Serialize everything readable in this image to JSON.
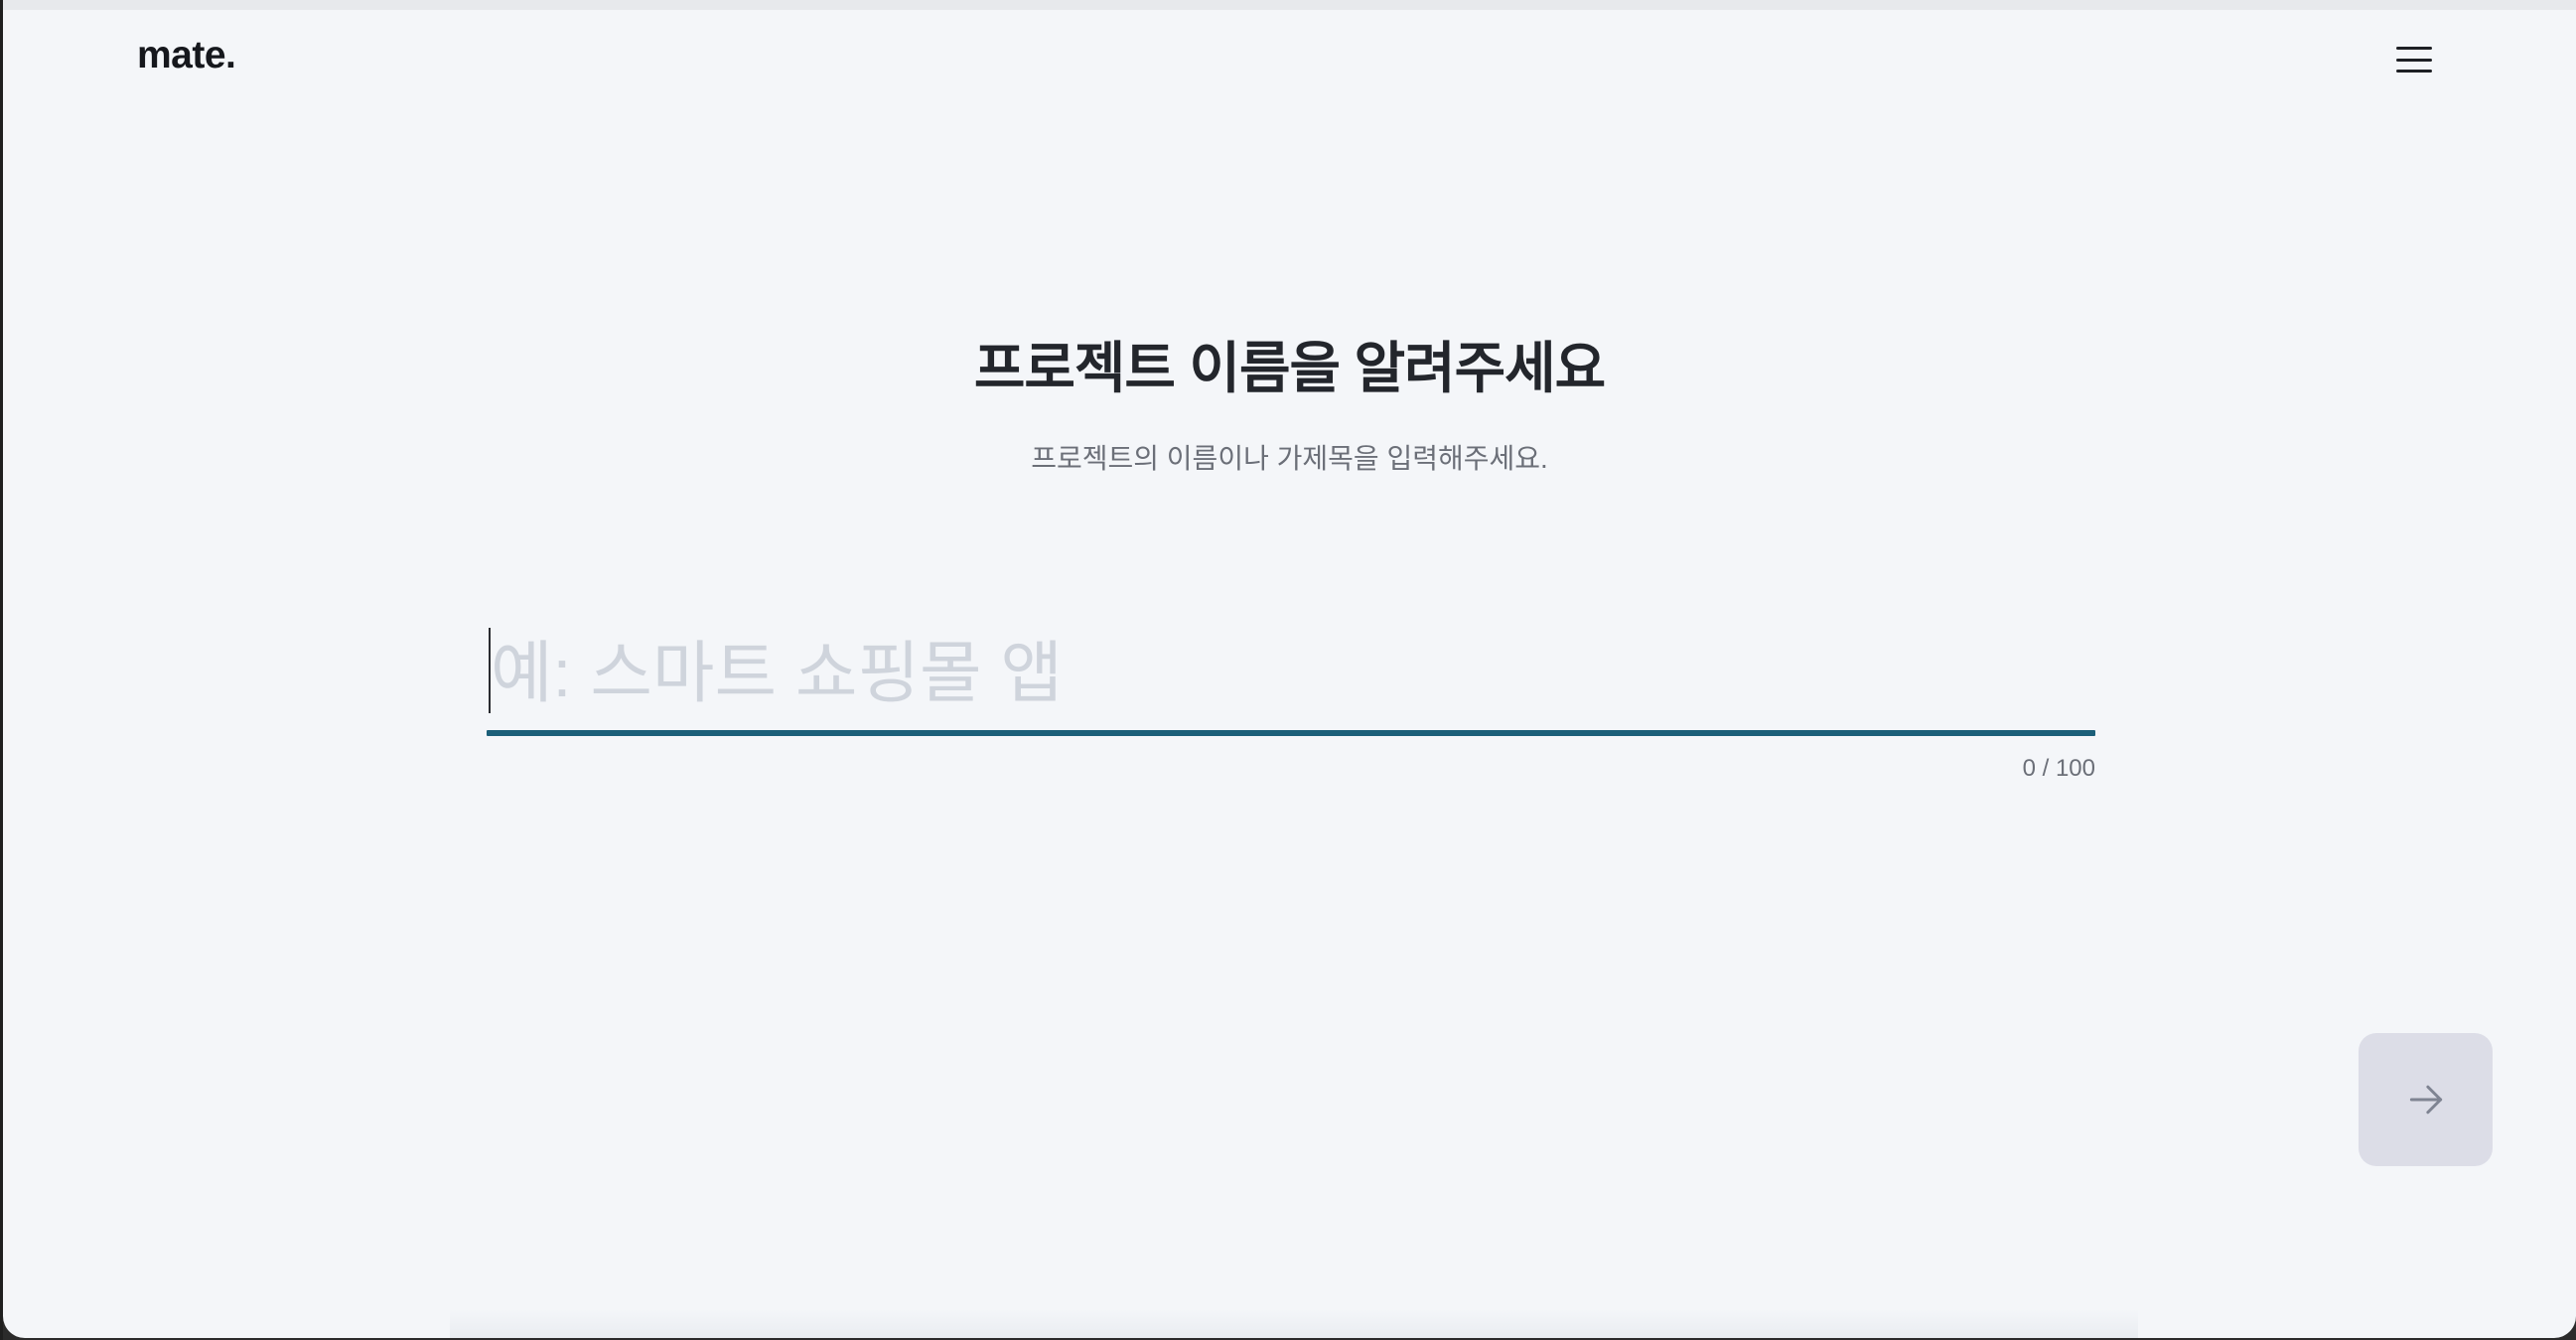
{
  "header": {
    "logo": "mate.",
    "menu_icon": "hamburger-menu-icon"
  },
  "main": {
    "title": "프로젝트 이름을 알려주세요",
    "subtitle": "프로젝트의 이름이나 가제목을 입력해주세요.",
    "project_name_input": {
      "value": "",
      "placeholder": "예: 스마트 쇼핑몰 앱"
    },
    "char_counter": "0 / 100"
  },
  "footer": {
    "next_icon": "arrow-right-icon"
  },
  "colors": {
    "background": "#f4f6f9",
    "accent_underline": "#1b5f79",
    "next_button_bg": "#dcdde7",
    "title_text": "#23262c",
    "muted_text": "#6b6f78"
  }
}
